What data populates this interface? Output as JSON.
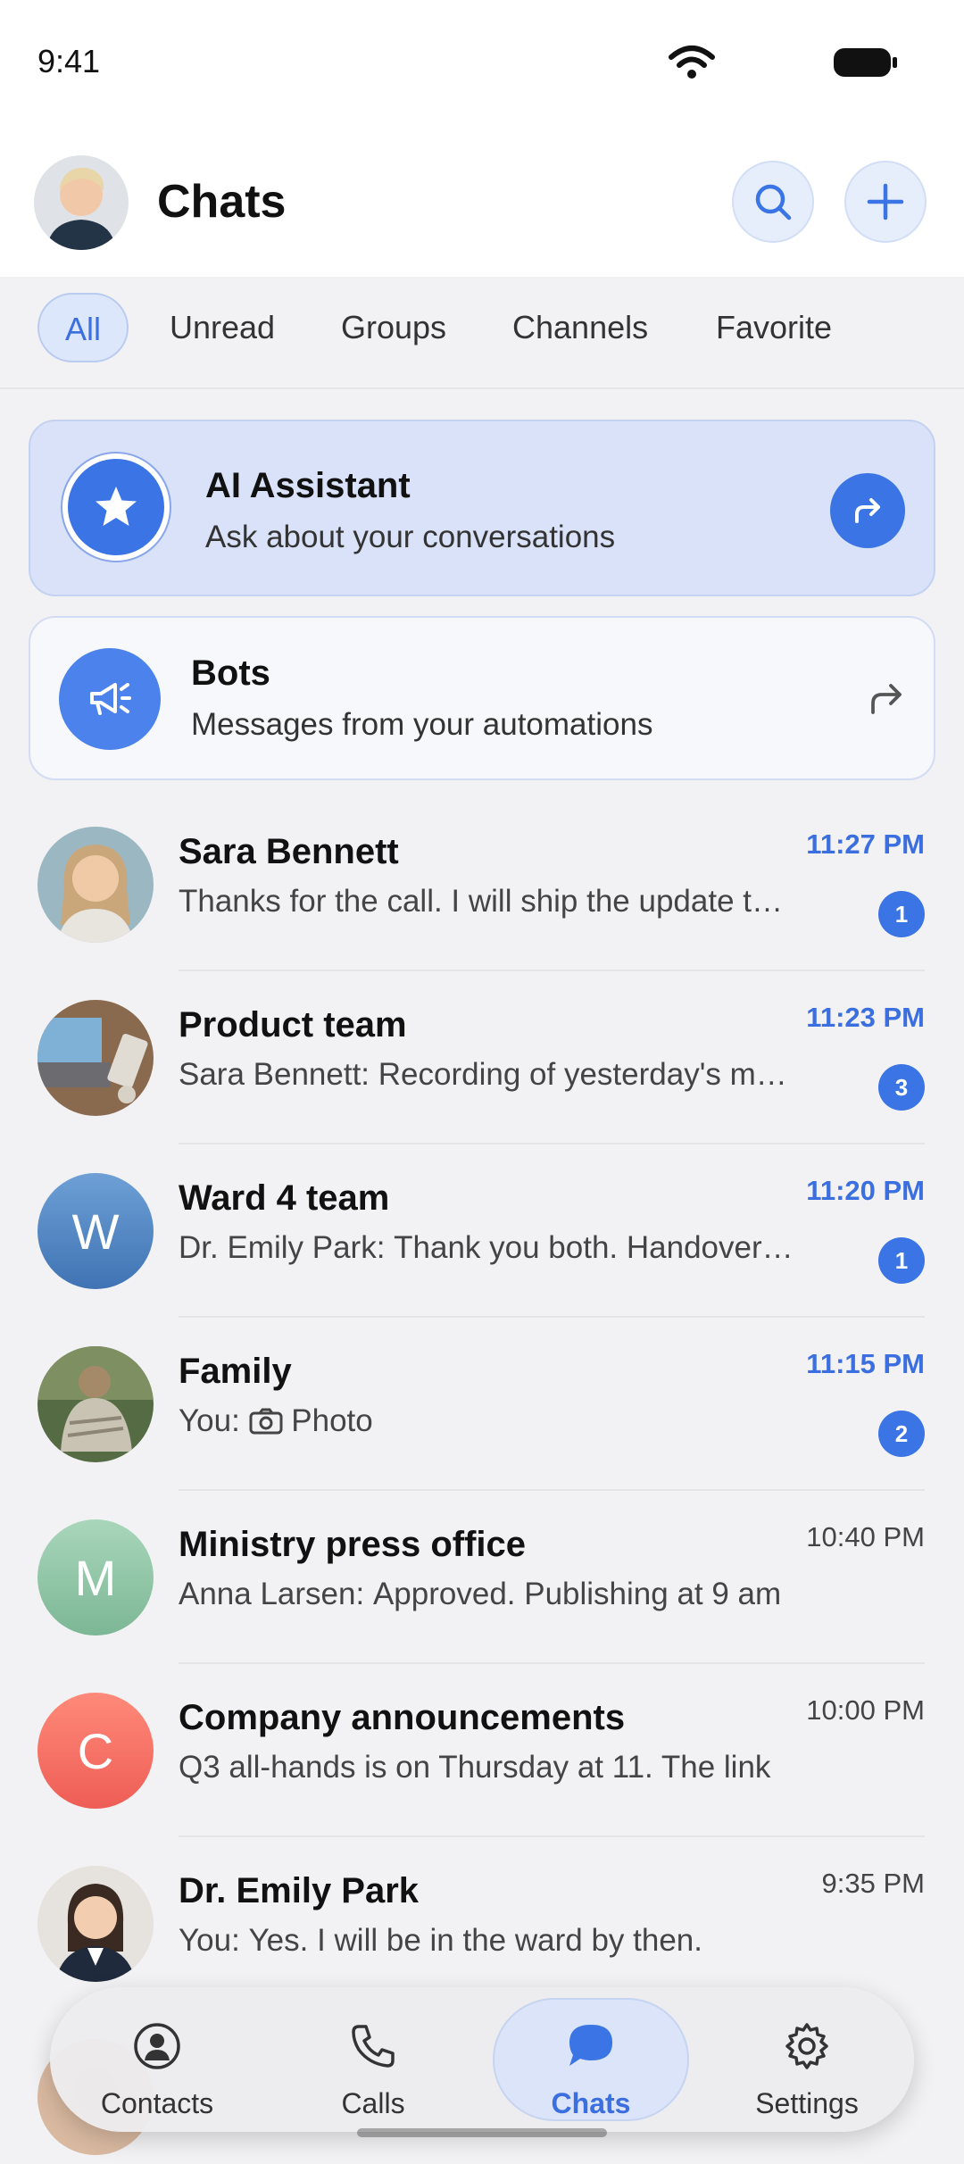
{
  "status_bar": {
    "time": "9:41"
  },
  "header": {
    "title": "Chats"
  },
  "filters": [
    {
      "label": "All",
      "active": true
    },
    {
      "label": "Unread",
      "active": false
    },
    {
      "label": "Groups",
      "active": false
    },
    {
      "label": "Channels",
      "active": false
    },
    {
      "label": "Favorite",
      "active": false
    }
  ],
  "ai_assistant": {
    "title": "AI Assistant",
    "subtitle": "Ask about your conversations"
  },
  "bots": {
    "title": "Bots",
    "subtitle": "Messages from your automations"
  },
  "chats": [
    {
      "name": "Sara Bennett",
      "sender": "",
      "preview": "Thanks for the call. I will ship the update tonight",
      "time": "11:27 PM",
      "unread": "1"
    },
    {
      "name": "Product team",
      "sender": "Sara Bennett:",
      "preview": "Recording of yesterday's meeting",
      "time": "11:23 PM",
      "unread": "3"
    },
    {
      "name": "Ward 4 team",
      "initial": "W",
      "sender": "Dr. Emily Park:",
      "preview": "Thank you both. Handover notes",
      "time": "11:20 PM",
      "unread": "1"
    },
    {
      "name": "Family",
      "sender": "You:",
      "preview": "Photo",
      "time": "11:15 PM",
      "unread": "2"
    },
    {
      "name": "Ministry press office",
      "initial": "M",
      "sender": "Anna Larsen:",
      "preview": "Approved. Publishing at 9 am",
      "time": "10:40 PM",
      "unread": ""
    },
    {
      "name": "Company announcements",
      "initial": "C",
      "sender": "",
      "preview": "Q3 all-hands is on Thursday at 11. The link",
      "time": "10:00 PM",
      "unread": ""
    },
    {
      "name": "Dr. Emily Park",
      "sender": "You:",
      "preview": "Yes. I will be in the ward by then.",
      "time": "9:35 PM",
      "unread": ""
    }
  ],
  "nav": {
    "contacts": "Contacts",
    "calls": "Calls",
    "chats": "Chats",
    "settings": "Settings"
  },
  "colors": {
    "accent": "#3b74e4",
    "ward": "#4f86c6",
    "ministry": "#8ec6a6",
    "company": "#f0675e"
  }
}
